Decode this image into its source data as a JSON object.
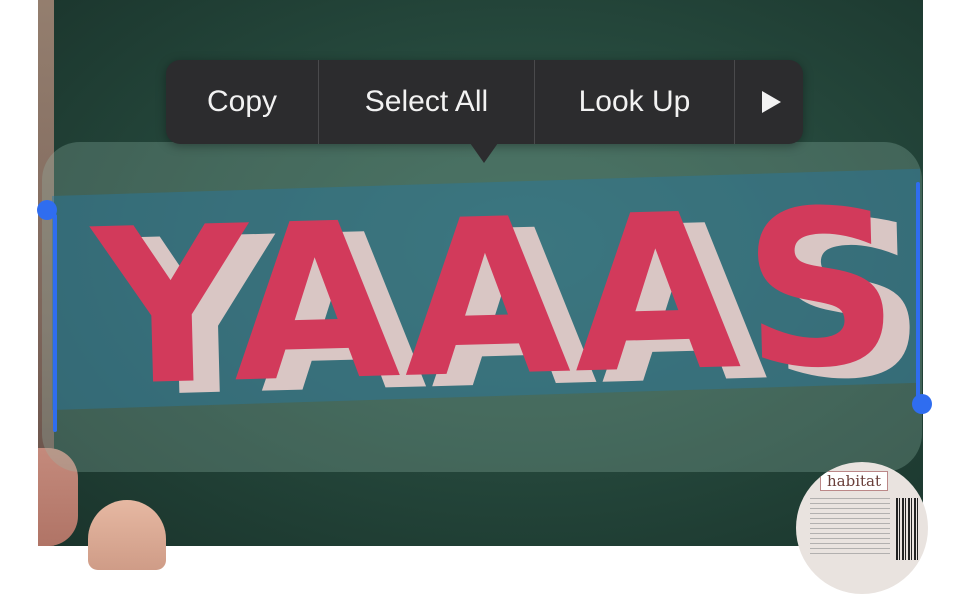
{
  "callout_menu": {
    "copy_label": "Copy",
    "select_all_label": "Select All",
    "look_up_label": "Look Up",
    "more_icon": "play-triangle-icon"
  },
  "photo": {
    "selected_text": "YAAAS",
    "sticker_brand": "habitat"
  },
  "colors": {
    "selection_handle": "#2f6df0",
    "menu_background": "#2c2c2e",
    "poster_letters": "#d23a5b"
  }
}
